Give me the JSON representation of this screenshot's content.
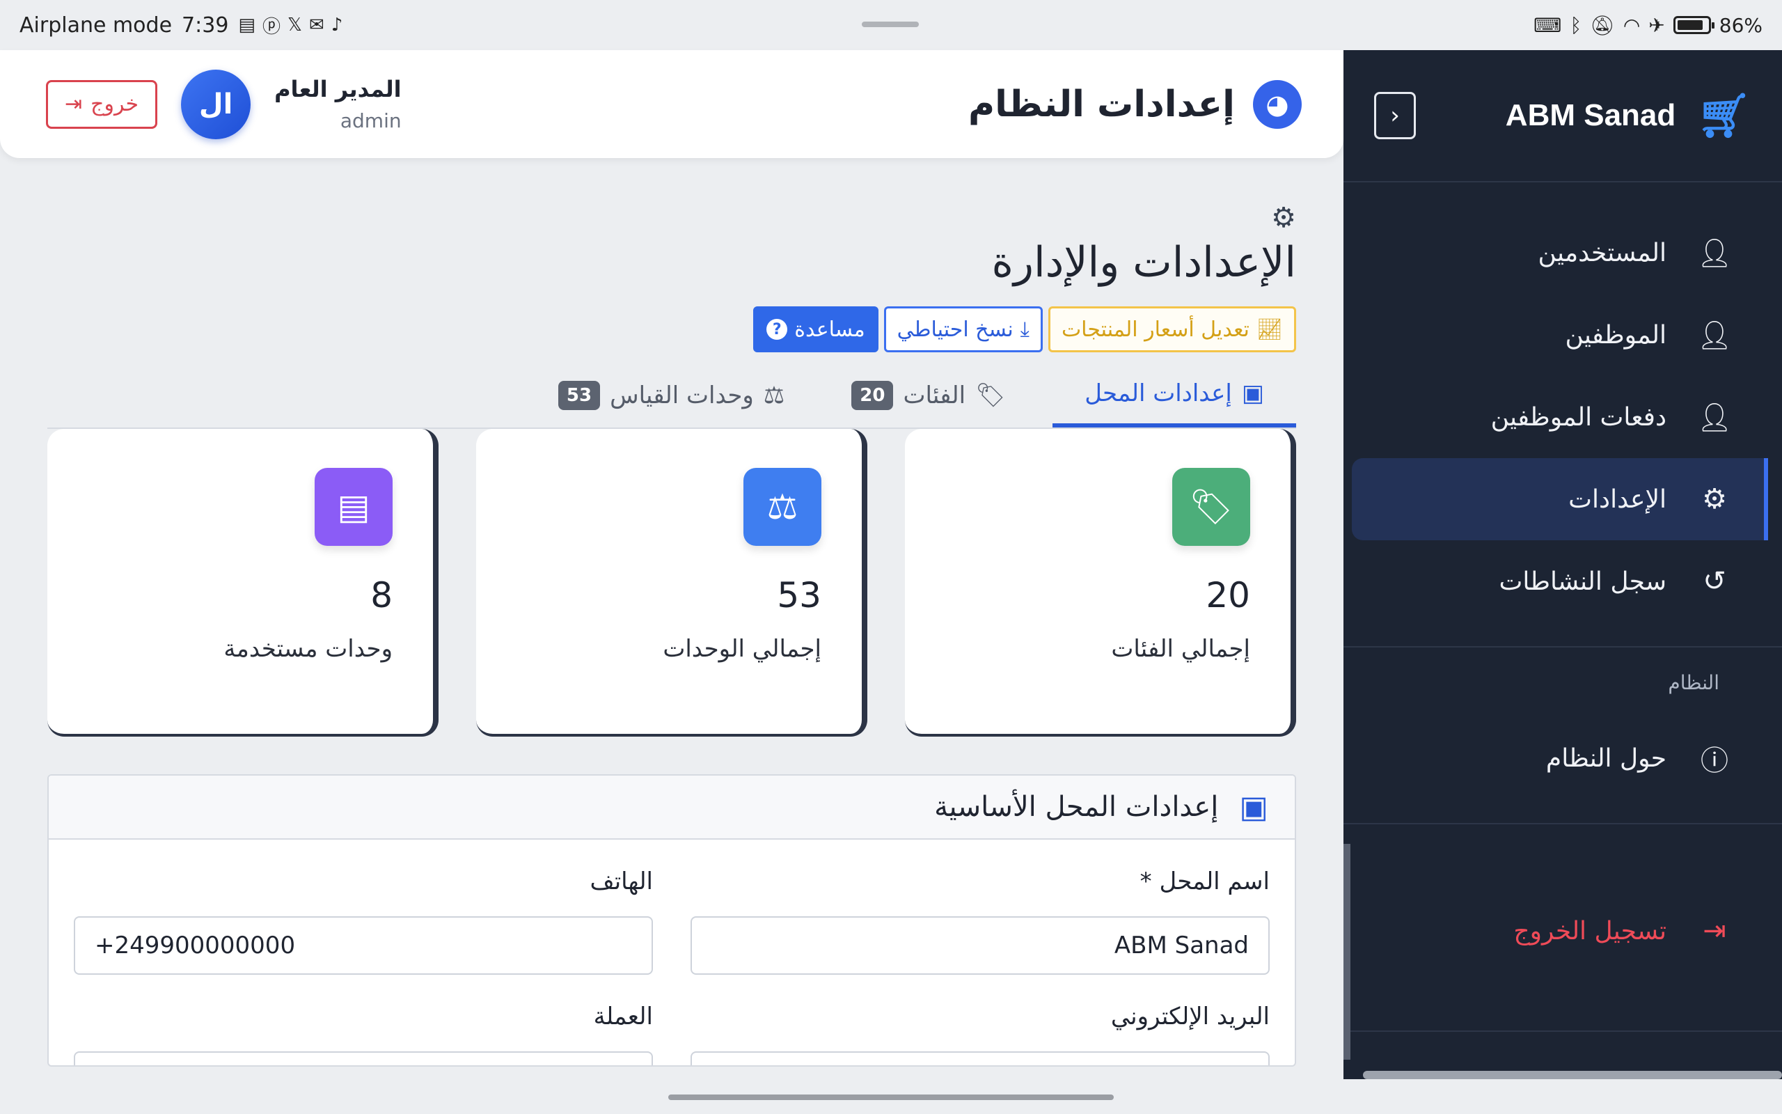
{
  "statusbar": {
    "mode": "Airplane mode",
    "time": "7:39",
    "notification_icons": [
      "pdf-icon",
      "pinterest-icon",
      "x-icon",
      "mail-icon",
      "tiktok-icon"
    ],
    "battery": "86%",
    "battery_level": 0.86
  },
  "header": {
    "title": "إعدادات النظام",
    "user_name": "المدير العام",
    "user_role": "admin",
    "avatar_initials": "ال",
    "logout_label": "خروج"
  },
  "sidebar": {
    "brand": "ABM Sanad",
    "items": [
      {
        "label": "المستخدمين",
        "icon": "users-cog-icon"
      },
      {
        "label": "الموظفين",
        "icon": "users-cog-icon"
      },
      {
        "label": "دفعات الموظفين",
        "icon": "users-cog-icon"
      },
      {
        "label": "الإعدادات",
        "icon": "cogs-icon",
        "active": true
      },
      {
        "label": "سجل النشاطات",
        "icon": "history-icon"
      }
    ],
    "section_label": "النظام",
    "about_label": "حول النظام",
    "logout_label": "تسجيل الخروج"
  },
  "page": {
    "title": "الإعدادات والإدارة",
    "actions": {
      "prices": "تعديل أسعار المنتجات",
      "backup": "نسخ احتياطي",
      "help": "مساعدة"
    },
    "tabs": [
      {
        "label": "إعدادات المحل",
        "active": true
      },
      {
        "label": "الفئات",
        "badge": "20"
      },
      {
        "label": "وحدات القياس",
        "badge": "53"
      }
    ],
    "cards": [
      {
        "value": "20",
        "label": "إجمالي الفئات",
        "color": "#4cae7a",
        "icon": "tags-icon"
      },
      {
        "value": "53",
        "label": "إجمالي الوحدات",
        "color": "#3f7ef0",
        "icon": "balance-scale-icon"
      },
      {
        "value": "8",
        "label": "وحدات مستخدمة",
        "color": "#8b5cf6",
        "icon": "box-icon"
      }
    ],
    "form": {
      "title": "إعدادات المحل الأساسية",
      "shop_name_label": "اسم المحل *",
      "shop_name_value": "ABM Sanad",
      "phone_label": "الهاتف",
      "phone_value": "+249900000000",
      "email_label": "البريد الإلكتروني",
      "currency_label": "العملة"
    }
  }
}
